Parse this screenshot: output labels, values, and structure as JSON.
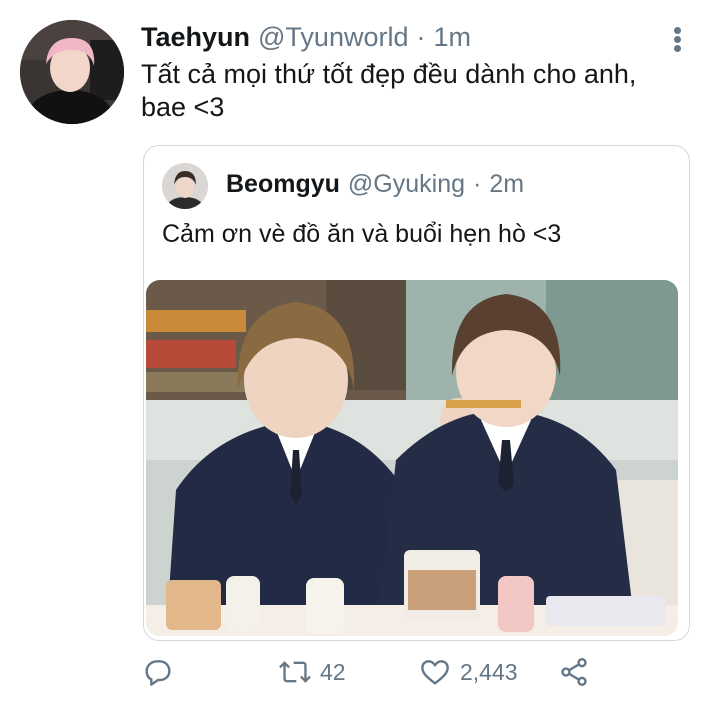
{
  "tweet": {
    "author_name": "Taehyun",
    "author_handle": "@Tyunworld",
    "separator": "·",
    "time": "1m",
    "text_line1": "Tất cả mọi thứ tốt đẹp đều dành cho anh,",
    "text_line2": "bae <3",
    "more_icon": "more-vertical-icon"
  },
  "quoted": {
    "author_name": "Beomgyu",
    "author_handle": "@Gyuking",
    "separator": "·",
    "time": "2m",
    "text": "Cảm ơn vè đồ ăn và buổi hẹn hò <3",
    "image_icon": "tweet-photo"
  },
  "actions": {
    "reply_icon": "reply-icon",
    "retweet_icon": "retweet-icon",
    "retweet_count": "42",
    "like_icon": "heart-icon",
    "like_count": "2,443",
    "share_icon": "share-icon"
  },
  "colors": {
    "text_primary": "#14171a",
    "text_secondary": "#657786",
    "border": "#cfd9de"
  }
}
